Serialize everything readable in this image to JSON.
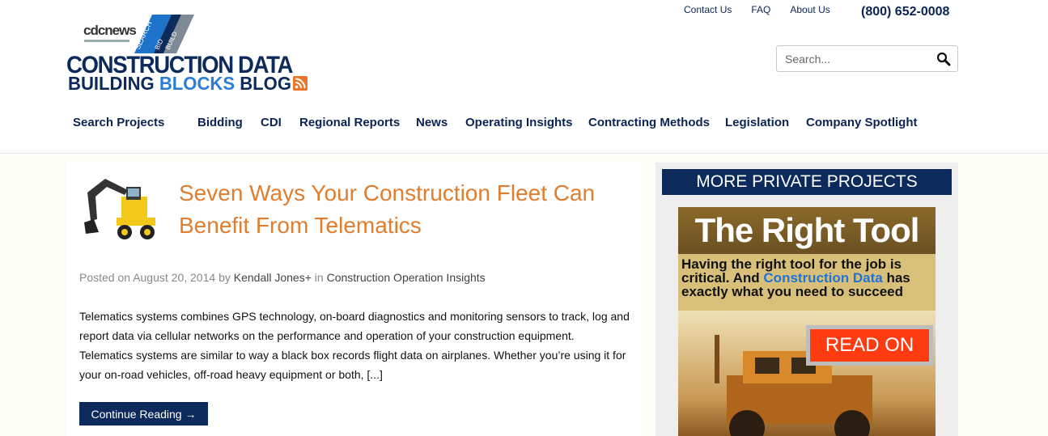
{
  "top_links": [
    "Contact Us",
    "FAQ",
    "About Us"
  ],
  "phone": "(800) 652-0008",
  "logo": {
    "cdc": "cdcnews",
    "banner": [
      "SEARCH",
      "BID",
      "BUILD"
    ],
    "line1": "CONSTRUCTION DATA",
    "line2_a": "BUILDING ",
    "line2_b": "BLOCKS",
    "line2_c": " BLOG"
  },
  "search": {
    "placeholder": "Search..."
  },
  "nav": [
    "Search Projects",
    "Bidding",
    "CDI",
    "Regional Reports",
    "News",
    "Operating Insights",
    "Contracting Methods",
    "Legislation",
    "Company Spotlight"
  ],
  "post": {
    "title": "Seven Ways Your Construction Fleet Can Benefit From Telematics",
    "posted_on": "Posted on",
    "date": "August 20, 2014",
    "by": "by",
    "author": "Kendall Jones+",
    "in": "in",
    "category": "Construction Operation Insights",
    "excerpt": "Telematics systems combines GPS technology, on-board diagnostics and monitoring sensors to track, log and report data via cellular networks on the performance and operation of your construction equipment. Telematics systems are similar to way a black box records flight data on airplanes. Whether you’re using it for your on-road vehicles, off-road heavy equipment or both, [...]",
    "continue": "Continue Reading →"
  },
  "sidebar": {
    "heading": "MORE PRIVATE PROJECTS",
    "ad_title": "The Right Tool",
    "ad_text_a": "Having the right tool for the job is critical. And ",
    "ad_text_b": "Construction Data",
    "ad_text_c": " has exactly what you need to succeed",
    "ad_button": "READ ON"
  },
  "colors": {
    "navy": "#0d2a5c",
    "orange": "#e07d2f",
    "accent_blue": "#2b7dd8"
  }
}
